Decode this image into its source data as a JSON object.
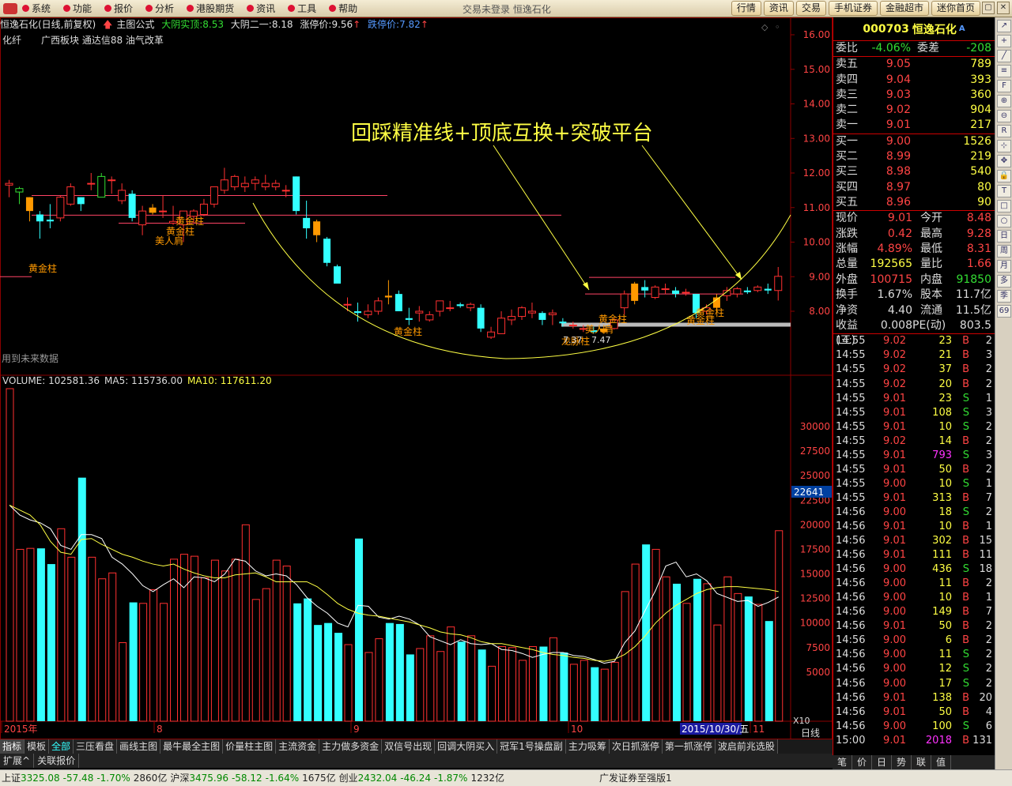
{
  "menu": {
    "items": [
      "系统",
      "功能",
      "报价",
      "分析",
      "港股期货",
      "资讯",
      "工具",
      "帮助"
    ],
    "center_text": "交易未登录  恒逸石化",
    "tabs": [
      "行情",
      "资讯",
      "交易",
      "手机证券",
      "金融超市",
      "迷你首页"
    ]
  },
  "header": {
    "stock": "恒逸石化(日线,前复权)",
    "formula": "主图公式",
    "big_yang_label": "大阴实顶:",
    "big_yang_val": "8.53",
    "big_yin_label": "大阴二一:",
    "big_yin_val": "8.18",
    "limit_up_label": "涨停价:",
    "limit_up_val": "9.56",
    "limit_down_label": "跌停价:",
    "limit_down_val": "7.82",
    "sector1": "化纤",
    "sector2": "广西板块 通达信88 油气改革",
    "future_note": "用到未来数据"
  },
  "annotation": "回踩精准线+顶底互换+突破平台",
  "candle_labels": {
    "golden": "黄金柱",
    "beauty": "美人肩",
    "dragon": "龙脉柱",
    "v1": "7.37",
    "v2": "7.47"
  },
  "volume_header": {
    "volume": "VOLUME: 102581.36",
    "ma5": "MA5: 115736.00",
    "ma10": "MA10: 117611.20"
  },
  "price_axis": [
    "16.00",
    "15.00",
    "14.00",
    "13.00",
    "12.00",
    "11.00",
    "10.00",
    "9.00",
    "8.00"
  ],
  "volume_axis": [
    "30000",
    "27500",
    "25000",
    "22500",
    "20000",
    "17500",
    "15000",
    "12500",
    "10000",
    "7500",
    "5000"
  ],
  "volume_marker": "22641",
  "x_axis": {
    "labels": [
      "2015年",
      "8",
      "9",
      "10",
      "11"
    ],
    "date_box": "2015/10/30/五",
    "scale": "X10",
    "period": "日线"
  },
  "bottom_tabs": [
    "指标",
    "模板",
    "全部",
    "三压看盘",
    "画线主图",
    "最牛最全主图",
    "价量柱主图",
    "主流资金",
    "主力做多资金",
    "双信号出现",
    "回调大阴买入",
    "冠军1号操盘副",
    "主力吸筹",
    "次日抓涨停",
    "第一抓涨停",
    "波启前兆选股"
  ],
  "sub_tabs": [
    "扩展^",
    "关联报价"
  ],
  "status": {
    "sh_label": "上证",
    "sh_val": "3325.08",
    "sh_chg": "-57.48",
    "sh_pct": "-1.70%",
    "sh_amt": "2860亿",
    "sz_label": "沪深",
    "sz_val": "3475.96",
    "sz_chg": "-58.12",
    "sz_pct": "-1.64%",
    "sz_amt": "1675亿",
    "cy_label": "创业",
    "cy_val": "2432.04",
    "cy_chg": "-46.24",
    "cy_pct": "-1.87%",
    "cy_amt": "1232亿",
    "broker": "广发证券至强版1"
  },
  "quote": {
    "code": "000703",
    "name": "恒逸石化",
    "weibi_label": "委比",
    "weibi_val": "-4.06%",
    "weicha_label": "委差",
    "weicha_val": "-208",
    "asks": [
      {
        "label": "卖五",
        "price": "9.05",
        "vol": "789"
      },
      {
        "label": "卖四",
        "price": "9.04",
        "vol": "393"
      },
      {
        "label": "卖三",
        "price": "9.03",
        "vol": "360"
      },
      {
        "label": "卖二",
        "price": "9.02",
        "vol": "904"
      },
      {
        "label": "卖一",
        "price": "9.01",
        "vol": "217"
      }
    ],
    "bids": [
      {
        "label": "买一",
        "price": "9.00",
        "vol": "1526"
      },
      {
        "label": "买二",
        "price": "8.99",
        "vol": "219"
      },
      {
        "label": "买三",
        "price": "8.98",
        "vol": "540"
      },
      {
        "label": "买四",
        "price": "8.97",
        "vol": "80"
      },
      {
        "label": "买五",
        "price": "8.96",
        "vol": "90"
      }
    ],
    "info": [
      {
        "l": "现价",
        "v": "9.01",
        "l2": "今开",
        "v2": "8.48"
      },
      {
        "l": "涨跌",
        "v": "0.42",
        "l2": "最高",
        "v2": "9.28"
      },
      {
        "l": "涨幅",
        "v": "4.89%",
        "l2": "最低",
        "v2": "8.31"
      },
      {
        "l": "总量",
        "v": "192565",
        "l2": "量比",
        "v2": "1.66"
      },
      {
        "l": "外盘",
        "v": "100715",
        "l2": "内盘",
        "v2": "91850"
      },
      {
        "l": "换手",
        "v": "1.67%",
        "l2": "股本",
        "v2": "11.7亿"
      },
      {
        "l": "净资",
        "v": "4.40",
        "l2": "流通",
        "v2": "11.5亿"
      },
      {
        "l": "收益(三)",
        "v": "0.008",
        "l2": "PE(动)",
        "v2": "803.5"
      }
    ],
    "ticks": [
      [
        "14:55",
        "9.02",
        "23",
        "B",
        "2"
      ],
      [
        "14:55",
        "9.02",
        "21",
        "B",
        "3"
      ],
      [
        "14:55",
        "9.02",
        "37",
        "B",
        "2"
      ],
      [
        "14:55",
        "9.02",
        "20",
        "B",
        "2"
      ],
      [
        "14:55",
        "9.01",
        "23",
        "S",
        "1"
      ],
      [
        "14:55",
        "9.01",
        "108",
        "S",
        "3"
      ],
      [
        "14:55",
        "9.01",
        "10",
        "S",
        "2"
      ],
      [
        "14:55",
        "9.02",
        "14",
        "B",
        "2"
      ],
      [
        "14:55",
        "9.01",
        "793",
        "S",
        "3"
      ],
      [
        "14:55",
        "9.01",
        "50",
        "B",
        "2"
      ],
      [
        "14:55",
        "9.00",
        "10",
        "S",
        "1"
      ],
      [
        "14:55",
        "9.01",
        "313",
        "B",
        "7"
      ],
      [
        "14:56",
        "9.00",
        "18",
        "S",
        "2"
      ],
      [
        "14:56",
        "9.01",
        "10",
        "B",
        "1"
      ],
      [
        "14:56",
        "9.01",
        "302",
        "B",
        "15"
      ],
      [
        "14:56",
        "9.01",
        "111",
        "B",
        "11"
      ],
      [
        "14:56",
        "9.00",
        "436",
        "S",
        "18"
      ],
      [
        "14:56",
        "9.00",
        "11",
        "B",
        "2"
      ],
      [
        "14:56",
        "9.00",
        "10",
        "B",
        "1"
      ],
      [
        "14:56",
        "9.00",
        "149",
        "B",
        "7"
      ],
      [
        "14:56",
        "9.01",
        "50",
        "B",
        "2"
      ],
      [
        "14:56",
        "9.00",
        "6",
        "B",
        "2"
      ],
      [
        "14:56",
        "9.00",
        "11",
        "S",
        "2"
      ],
      [
        "14:56",
        "9.00",
        "12",
        "S",
        "2"
      ],
      [
        "14:56",
        "9.00",
        "17",
        "S",
        "2"
      ],
      [
        "14:56",
        "9.01",
        "138",
        "B",
        "20"
      ],
      [
        "14:56",
        "9.01",
        "50",
        "B",
        "4"
      ],
      [
        "14:56",
        "9.00",
        "100",
        "S",
        "6"
      ],
      [
        "15:00",
        "9.01",
        "2018",
        "B",
        "131"
      ]
    ],
    "foot": [
      "笔",
      "价",
      "日",
      "势",
      "联",
      "值"
    ]
  },
  "colors": {
    "up": "#ff3030",
    "down": "#33ffff",
    "golden": "#ff9900",
    "ma5": "#ffffff",
    "ma10": "#ffff44"
  },
  "chart_data": {
    "type": "candlestick",
    "x": [
      "2015年",
      "8",
      "9",
      "10",
      "11"
    ],
    "ylim": [
      7.0,
      16.4
    ],
    "price_axis_ticks": [
      16,
      15,
      14,
      13,
      12,
      11,
      10,
      9,
      8
    ],
    "candles": [
      [
        11.65,
        11.8,
        11.3,
        11.7
      ],
      [
        11.45,
        11.6,
        11.1,
        11.55
      ],
      [
        10.9,
        11.3,
        10.6,
        11.3
      ],
      [
        10.8,
        10.9,
        10.1,
        10.6
      ],
      [
        10.65,
        11.1,
        10.4,
        10.6
      ],
      [
        10.7,
        11.35,
        10.6,
        11.3
      ],
      [
        11.1,
        11.7,
        11.05,
        11.6
      ],
      [
        11.3,
        11.3,
        10.9,
        11.1
      ],
      [
        11.7,
        12.0,
        11.5,
        11.7
      ],
      [
        11.3,
        12.0,
        11.3,
        11.9
      ],
      [
        11.8,
        11.9,
        11.4,
        11.8
      ],
      [
        11.2,
        11.7,
        11.1,
        11.5
      ],
      [
        11.4,
        11.5,
        10.6,
        10.7
      ],
      [
        10.5,
        11.05,
        10.2,
        10.9
      ],
      [
        10.85,
        11.1,
        10.8,
        11.0
      ],
      [
        10.9,
        11.35,
        10.7,
        10.9
      ],
      [
        10.55,
        11.05,
        10.5,
        10.6
      ],
      [
        10.5,
        10.9,
        10.0,
        10.9
      ],
      [
        10.75,
        10.95,
        10.55,
        10.9
      ],
      [
        10.8,
        11.25,
        10.75,
        11.1
      ],
      [
        11.1,
        11.6,
        11.0,
        11.6
      ],
      [
        11.5,
        12.15,
        11.4,
        11.8
      ],
      [
        11.6,
        11.95,
        11.5,
        11.9
      ],
      [
        11.6,
        11.9,
        11.45,
        11.7
      ],
      [
        11.7,
        11.9,
        11.5,
        11.8
      ],
      [
        11.6,
        11.95,
        11.5,
        11.7
      ],
      [
        11.6,
        11.8,
        11.5,
        11.7
      ],
      [
        11.5,
        11.65,
        11.3,
        11.5
      ],
      [
        11.9,
        11.9,
        10.8,
        10.9
      ],
      [
        10.7,
        11.2,
        10.1,
        10.4
      ],
      [
        10.6,
        10.65,
        10.0,
        10.2
      ],
      [
        10.1,
        10.15,
        9.3,
        9.4
      ],
      [
        9.3,
        9.35,
        8.8,
        8.8
      ],
      [
        8.2,
        8.4,
        8.0,
        8.2
      ],
      [
        8.0,
        8.25,
        7.7,
        7.95
      ],
      [
        7.9,
        8.2,
        7.8,
        8.0
      ],
      [
        8.0,
        8.4,
        7.9,
        8.3
      ],
      [
        8.45,
        8.9,
        8.2,
        8.4
      ],
      [
        8.5,
        8.6,
        8.0,
        8.0
      ],
      [
        7.8,
        8.1,
        7.6,
        7.75
      ],
      [
        7.95,
        8.15,
        7.7,
        8.0
      ],
      [
        7.75,
        8.0,
        7.7,
        7.9
      ],
      [
        8.0,
        8.3,
        7.85,
        8.3
      ],
      [
        8.1,
        8.3,
        8.0,
        8.1
      ],
      [
        8.2,
        8.25,
        8.1,
        8.15
      ],
      [
        8.1,
        8.25,
        8.0,
        8.2
      ],
      [
        8.1,
        8.2,
        7.4,
        7.5
      ],
      [
        7.25,
        7.55,
        7.2,
        7.4
      ],
      [
        7.35,
        8.0,
        7.35,
        7.8
      ],
      [
        7.75,
        8.05,
        7.6,
        7.85
      ],
      [
        7.85,
        8.15,
        7.75,
        8.1
      ],
      [
        7.95,
        8.25,
        7.8,
        8.0
      ],
      [
        7.95,
        8.0,
        7.6,
        7.75
      ],
      [
        7.9,
        8.05,
        7.6,
        7.95
      ],
      [
        7.7,
        7.8,
        7.55,
        7.65
      ],
      [
        7.6,
        7.7,
        7.5,
        7.6
      ],
      [
        7.5,
        7.6,
        7.4,
        7.5
      ],
      [
        7.45,
        7.55,
        7.35,
        7.4
      ],
      [
        7.4,
        7.6,
        7.35,
        7.5
      ],
      [
        7.5,
        7.8,
        7.47,
        7.75
      ],
      [
        8.1,
        8.6,
        7.9,
        8.5
      ],
      [
        8.3,
        8.85,
        8.2,
        8.8
      ],
      [
        8.7,
        8.9,
        8.4,
        8.6
      ],
      [
        8.4,
        8.75,
        8.35,
        8.7
      ],
      [
        8.65,
        8.8,
        8.5,
        8.65
      ],
      [
        8.6,
        8.7,
        8.4,
        8.5
      ],
      [
        8.55,
        8.65,
        8.45,
        8.55
      ],
      [
        8.5,
        8.5,
        7.8,
        7.95
      ],
      [
        8.0,
        8.2,
        7.9,
        8.1
      ],
      [
        8.1,
        8.5,
        8.0,
        8.4
      ],
      [
        8.45,
        8.7,
        8.3,
        8.6
      ],
      [
        8.5,
        8.7,
        8.4,
        8.65
      ],
      [
        8.6,
        8.7,
        8.5,
        8.55
      ],
      [
        8.6,
        8.75,
        8.55,
        8.7
      ],
      [
        8.65,
        8.8,
        8.5,
        8.6
      ],
      [
        8.6,
        9.28,
        8.31,
        9.01
      ]
    ],
    "volume": [
      38000,
      17500,
      17600,
      17600,
      16000,
      19600,
      16700,
      24800,
      16700,
      14500,
      15100,
      8000,
      12100,
      12000,
      13400,
      12000,
      16500,
      17000,
      16800,
      14600,
      16400,
      15300,
      16500,
      20000,
      12400,
      13500,
      16400,
      15800,
      12000,
      12500,
      9800,
      10000,
      9000,
      7800,
      18600,
      7000,
      8400,
      10000,
      9900,
      6800,
      7400,
      8700,
      7100,
      9600,
      8100,
      8700,
      7300,
      5600,
      7600,
      7500,
      6200,
      7600,
      7600,
      8500,
      7000,
      5800,
      6200,
      5500,
      5300,
      6000,
      13200,
      16000,
      18000,
      17500,
      14700,
      14000,
      12000,
      14500,
      14000,
      9800,
      14700,
      13000,
      12700,
      11900,
      10200,
      19400
    ],
    "ma5": [
      22000,
      21000,
      20500,
      20200,
      19600,
      17900,
      17500,
      19000,
      19000,
      18600,
      16700,
      16000,
      15000,
      13800,
      13200,
      13900,
      14500,
      13600,
      14700,
      14600,
      14200,
      15000,
      16500,
      16300,
      15300,
      14800,
      15000,
      14800,
      13900,
      12600,
      11700,
      11000,
      10000,
      9600,
      11800,
      11700,
      10600,
      10400,
      10700,
      10400,
      9800,
      8600,
      8200,
      7800,
      8300,
      7900,
      7800,
      7900,
      7300,
      7200,
      6900,
      6500,
      6800,
      7000,
      7000,
      6700,
      6600,
      6300,
      5900,
      6100,
      8000,
      9200,
      11300,
      13300,
      15800,
      16200,
      14700,
      15000,
      14300,
      13000,
      12600,
      12200,
      12300,
      11700,
      12100,
      12650
    ],
    "ma10": [
      22000,
      21500,
      21000,
      20000,
      18300,
      17200,
      17000,
      18500,
      18600,
      18000,
      17500,
      17000,
      16700,
      16300,
      16000,
      15800,
      16000,
      15500,
      15100,
      14800,
      14600,
      14600,
      14900,
      15000,
      15100,
      14700,
      14200,
      14200,
      14200,
      14200,
      13700,
      12900,
      12000,
      11400,
      11000,
      10800,
      10700,
      10500,
      10300,
      10100,
      9800,
      9500,
      9100,
      8900,
      8800,
      8500,
      8100,
      7900,
      7900,
      7700,
      7500,
      7300,
      7000,
      6800,
      6700,
      6500,
      6400,
      6200,
      6100,
      6300,
      6800,
      7600,
      8700,
      10000,
      11000,
      11800,
      12400,
      13000,
      13400,
      13600,
      13700,
      13700,
      13600,
      13500,
      13400,
      13200
    ]
  }
}
